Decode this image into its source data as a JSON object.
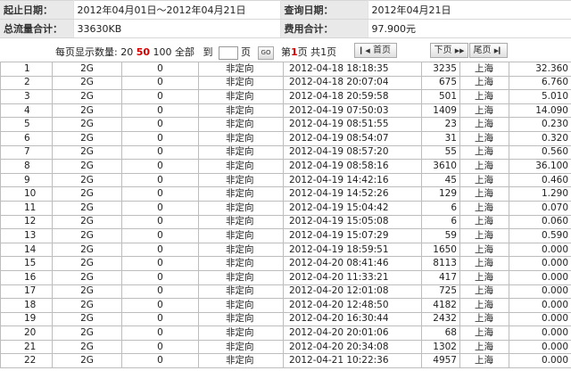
{
  "summary": {
    "date_range_label": "起止日期：",
    "date_range_value": "2012年04月01日～2012年04月21日",
    "query_date_label": "查询日期：",
    "query_date_value": "2012年04月21日",
    "total_flow_label": "总流量合计：",
    "total_flow_value": "33630KB",
    "total_fee_label": "费用合计：",
    "total_fee_value": "97.900元"
  },
  "pager": {
    "per_page_label": "每页显示数量:",
    "opt20": "20",
    "opt50": "50",
    "opt100": "100",
    "opt_all": "全部",
    "goto_label": "到",
    "page_unit": "页",
    "go_label": "GO",
    "page_prefix": "第",
    "current_page": "1",
    "page_mid": "页 共",
    "total_pages": "1",
    "page_suffix": "页",
    "first_label": "首页",
    "next_label": "下页",
    "last_label": "尾页"
  },
  "records": [
    [
      "1",
      "2G",
      "0",
      "非定向",
      "2012-04-18 18:18:35",
      "3235",
      "上海",
      "32.360"
    ],
    [
      "2",
      "2G",
      "0",
      "非定向",
      "2012-04-18 20:07:04",
      "675",
      "上海",
      "6.760"
    ],
    [
      "3",
      "2G",
      "0",
      "非定向",
      "2012-04-18 20:59:58",
      "501",
      "上海",
      "5.010"
    ],
    [
      "4",
      "2G",
      "0",
      "非定向",
      "2012-04-19 07:50:03",
      "1409",
      "上海",
      "14.090"
    ],
    [
      "5",
      "2G",
      "0",
      "非定向",
      "2012-04-19 08:51:55",
      "23",
      "上海",
      "0.230"
    ],
    [
      "6",
      "2G",
      "0",
      "非定向",
      "2012-04-19 08:54:07",
      "31",
      "上海",
      "0.320"
    ],
    [
      "7",
      "2G",
      "0",
      "非定向",
      "2012-04-19 08:57:20",
      "55",
      "上海",
      "0.560"
    ],
    [
      "8",
      "2G",
      "0",
      "非定向",
      "2012-04-19 08:58:16",
      "3610",
      "上海",
      "36.100"
    ],
    [
      "9",
      "2G",
      "0",
      "非定向",
      "2012-04-19 14:42:16",
      "45",
      "上海",
      "0.460"
    ],
    [
      "10",
      "2G",
      "0",
      "非定向",
      "2012-04-19 14:52:26",
      "129",
      "上海",
      "1.290"
    ],
    [
      "11",
      "2G",
      "0",
      "非定向",
      "2012-04-19 15:04:42",
      "6",
      "上海",
      "0.070"
    ],
    [
      "12",
      "2G",
      "0",
      "非定向",
      "2012-04-19 15:05:08",
      "6",
      "上海",
      "0.060"
    ],
    [
      "13",
      "2G",
      "0",
      "非定向",
      "2012-04-19 15:07:29",
      "59",
      "上海",
      "0.590"
    ],
    [
      "14",
      "2G",
      "0",
      "非定向",
      "2012-04-19 18:59:51",
      "1650",
      "上海",
      "0.000"
    ],
    [
      "15",
      "2G",
      "0",
      "非定向",
      "2012-04-20 08:41:46",
      "8113",
      "上海",
      "0.000"
    ],
    [
      "16",
      "2G",
      "0",
      "非定向",
      "2012-04-20 11:33:21",
      "417",
      "上海",
      "0.000"
    ],
    [
      "17",
      "2G",
      "0",
      "非定向",
      "2012-04-20 12:01:08",
      "725",
      "上海",
      "0.000"
    ],
    [
      "18",
      "2G",
      "0",
      "非定向",
      "2012-04-20 12:48:50",
      "4182",
      "上海",
      "0.000"
    ],
    [
      "19",
      "2G",
      "0",
      "非定向",
      "2012-04-20 16:30:44",
      "2432",
      "上海",
      "0.000"
    ],
    [
      "20",
      "2G",
      "0",
      "非定向",
      "2012-04-20 20:01:06",
      "68",
      "上海",
      "0.000"
    ],
    [
      "21",
      "2G",
      "0",
      "非定向",
      "2012-04-20 20:34:08",
      "1302",
      "上海",
      "0.000"
    ],
    [
      "22",
      "2G",
      "0",
      "非定向",
      "2012-04-21 10:22:36",
      "4957",
      "上海",
      "0.000"
    ]
  ],
  "icons": {
    "first": "first-page-icon",
    "next": "next-page-icon",
    "last": "last-page-icon"
  }
}
